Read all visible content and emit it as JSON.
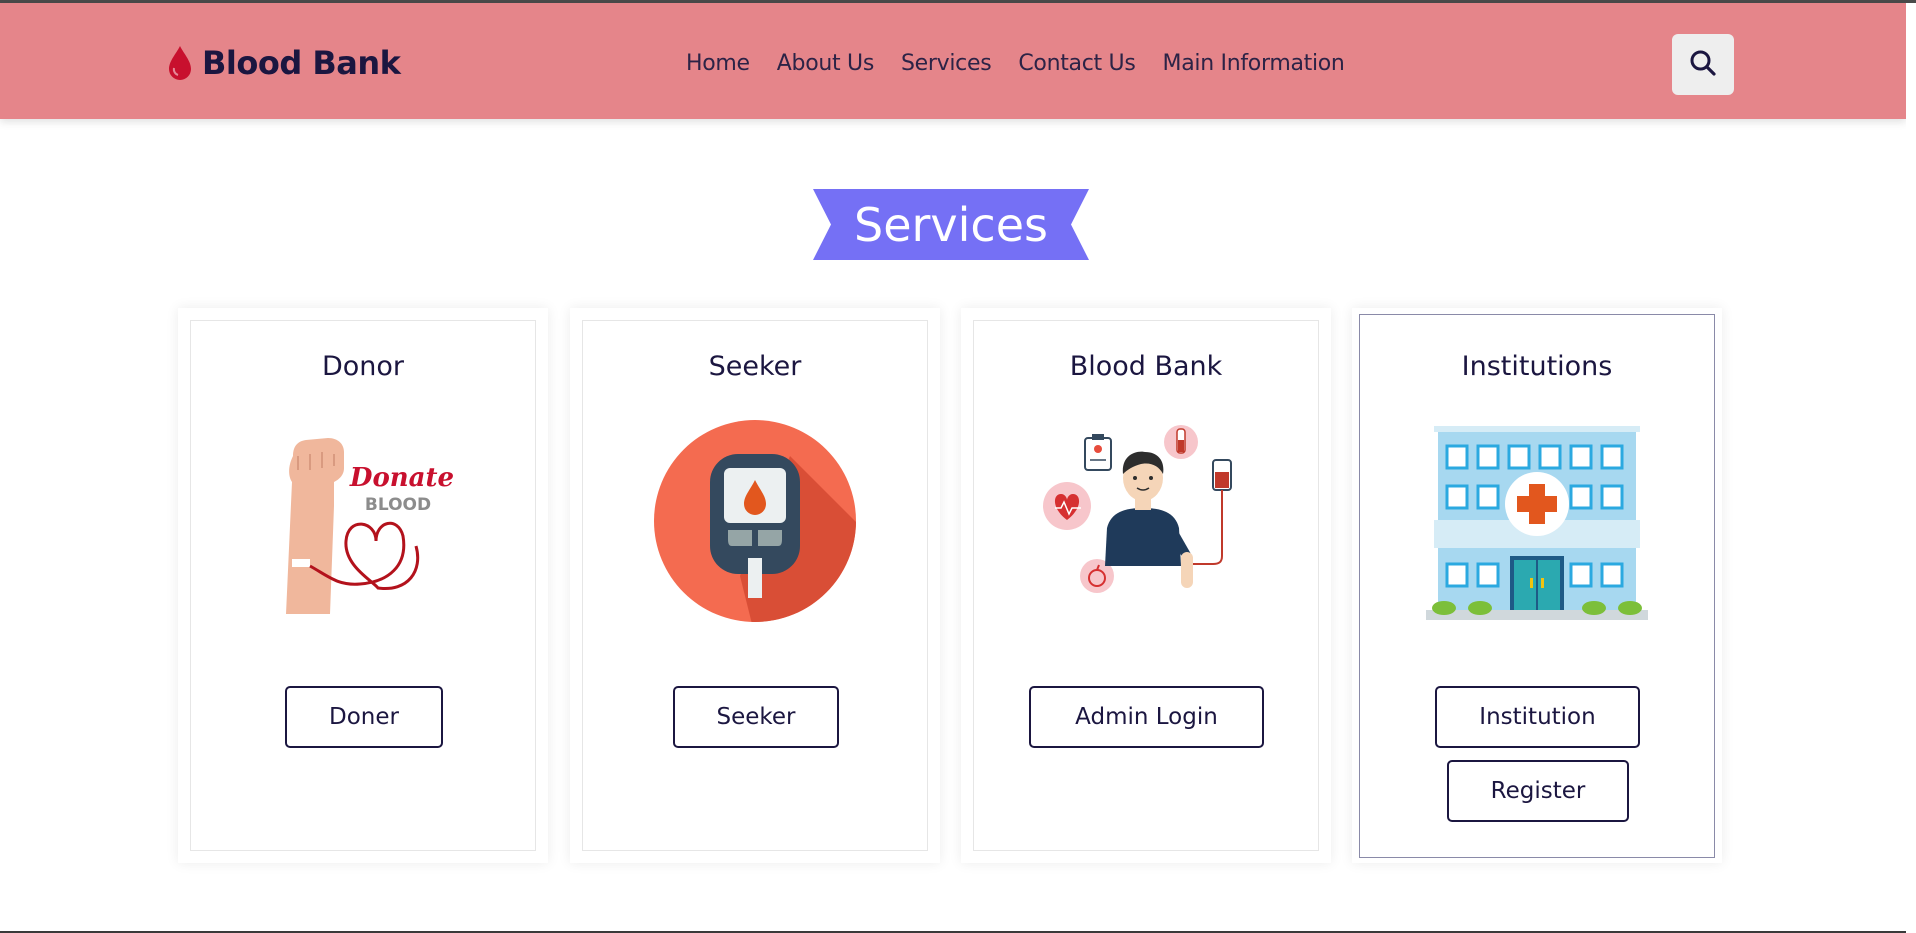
{
  "header": {
    "logo_text": "Blood Bank",
    "logo_icon": "blood-drop-icon",
    "nav": [
      {
        "label": "Home"
      },
      {
        "label": "About Us"
      },
      {
        "label": "Services"
      },
      {
        "label": "Contact Us"
      },
      {
        "label": "Main Information"
      }
    ],
    "search_icon": "search-icon"
  },
  "section": {
    "title": "Services"
  },
  "cards": [
    {
      "title": "Donor",
      "image": "donate-blood-illustration",
      "buttons": [
        {
          "label": "Doner"
        }
      ]
    },
    {
      "title": "Seeker",
      "image": "glucometer-illustration",
      "buttons": [
        {
          "label": "Seeker"
        }
      ]
    },
    {
      "title": "Blood Bank",
      "image": "blood-donor-person-illustration",
      "buttons": [
        {
          "label": "Admin Login"
        }
      ]
    },
    {
      "title": "Institutions",
      "image": "hospital-building-illustration",
      "buttons": [
        {
          "label": "Institution"
        },
        {
          "label": "Register"
        }
      ]
    }
  ],
  "illustration_text": {
    "donate": "Donate",
    "blood": "BLOOD"
  },
  "colors": {
    "header_bg": "#e5858a",
    "ribbon": "#7570f5",
    "text_dark": "#1b1640",
    "blood_red": "#c8102e"
  }
}
